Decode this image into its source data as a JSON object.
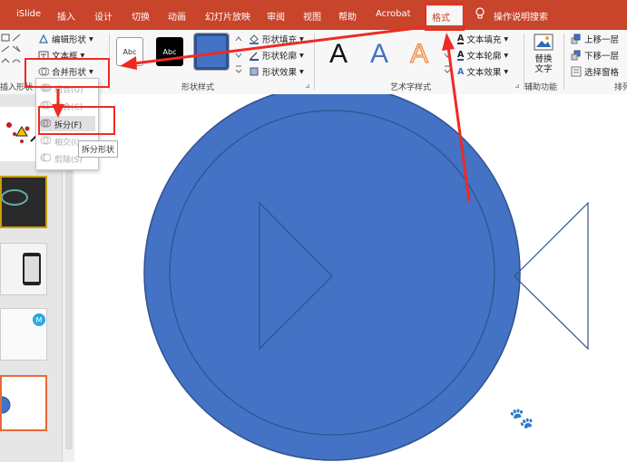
{
  "tabs": [
    "iSlide",
    "插入",
    "设计",
    "切换",
    "动画",
    "幻灯片放映",
    "审阅",
    "视图",
    "帮助",
    "Acrobat",
    "格式"
  ],
  "active_tab": "格式",
  "tell_me": "操作说明搜索",
  "insert_shapes": {
    "edit_shape": "编辑形状",
    "text_box": "文本框",
    "merge_shapes": "合并形状",
    "group_label": "插入形状"
  },
  "merge_menu": {
    "items": [
      {
        "label": "组合(U)",
        "enabled": false
      },
      {
        "label": "组合(C)",
        "enabled": false
      },
      {
        "label": "拆分(F)",
        "enabled": true
      },
      {
        "label": "相交(I)",
        "enabled": false
      },
      {
        "label": "剪除(S)",
        "enabled": false
      }
    ],
    "tooltip": "拆分形状"
  },
  "shape_styles": {
    "swatches": [
      "Abc",
      "Abc",
      ""
    ],
    "fill": "形状填充",
    "outline": "形状轮廓",
    "effects": "形状效果",
    "group_label": "形状样式"
  },
  "wordart": {
    "letters": [
      "A",
      "A",
      "A"
    ],
    "text_fill": "文本填充",
    "text_outline": "文本轮廓",
    "text_effects": "文本效果",
    "group_label": "艺术字样式"
  },
  "accessibility": {
    "alt_text": "替换文字",
    "group_label": "辅助功能"
  },
  "arrange": {
    "bring_forward": "上移一层",
    "send_backward": "下移一层",
    "selection_pane": "选择窗格",
    "group_label": "排列"
  },
  "colors": {
    "ribbon_red": "#c8442a",
    "shape_blue": "#4472c4",
    "shape_stroke": "#2f528f",
    "annotation_red": "#ee2b22"
  },
  "watermark": {
    "brand": "Bai",
    "brand2": "经验",
    "url": "jingyan.baidu.com"
  }
}
